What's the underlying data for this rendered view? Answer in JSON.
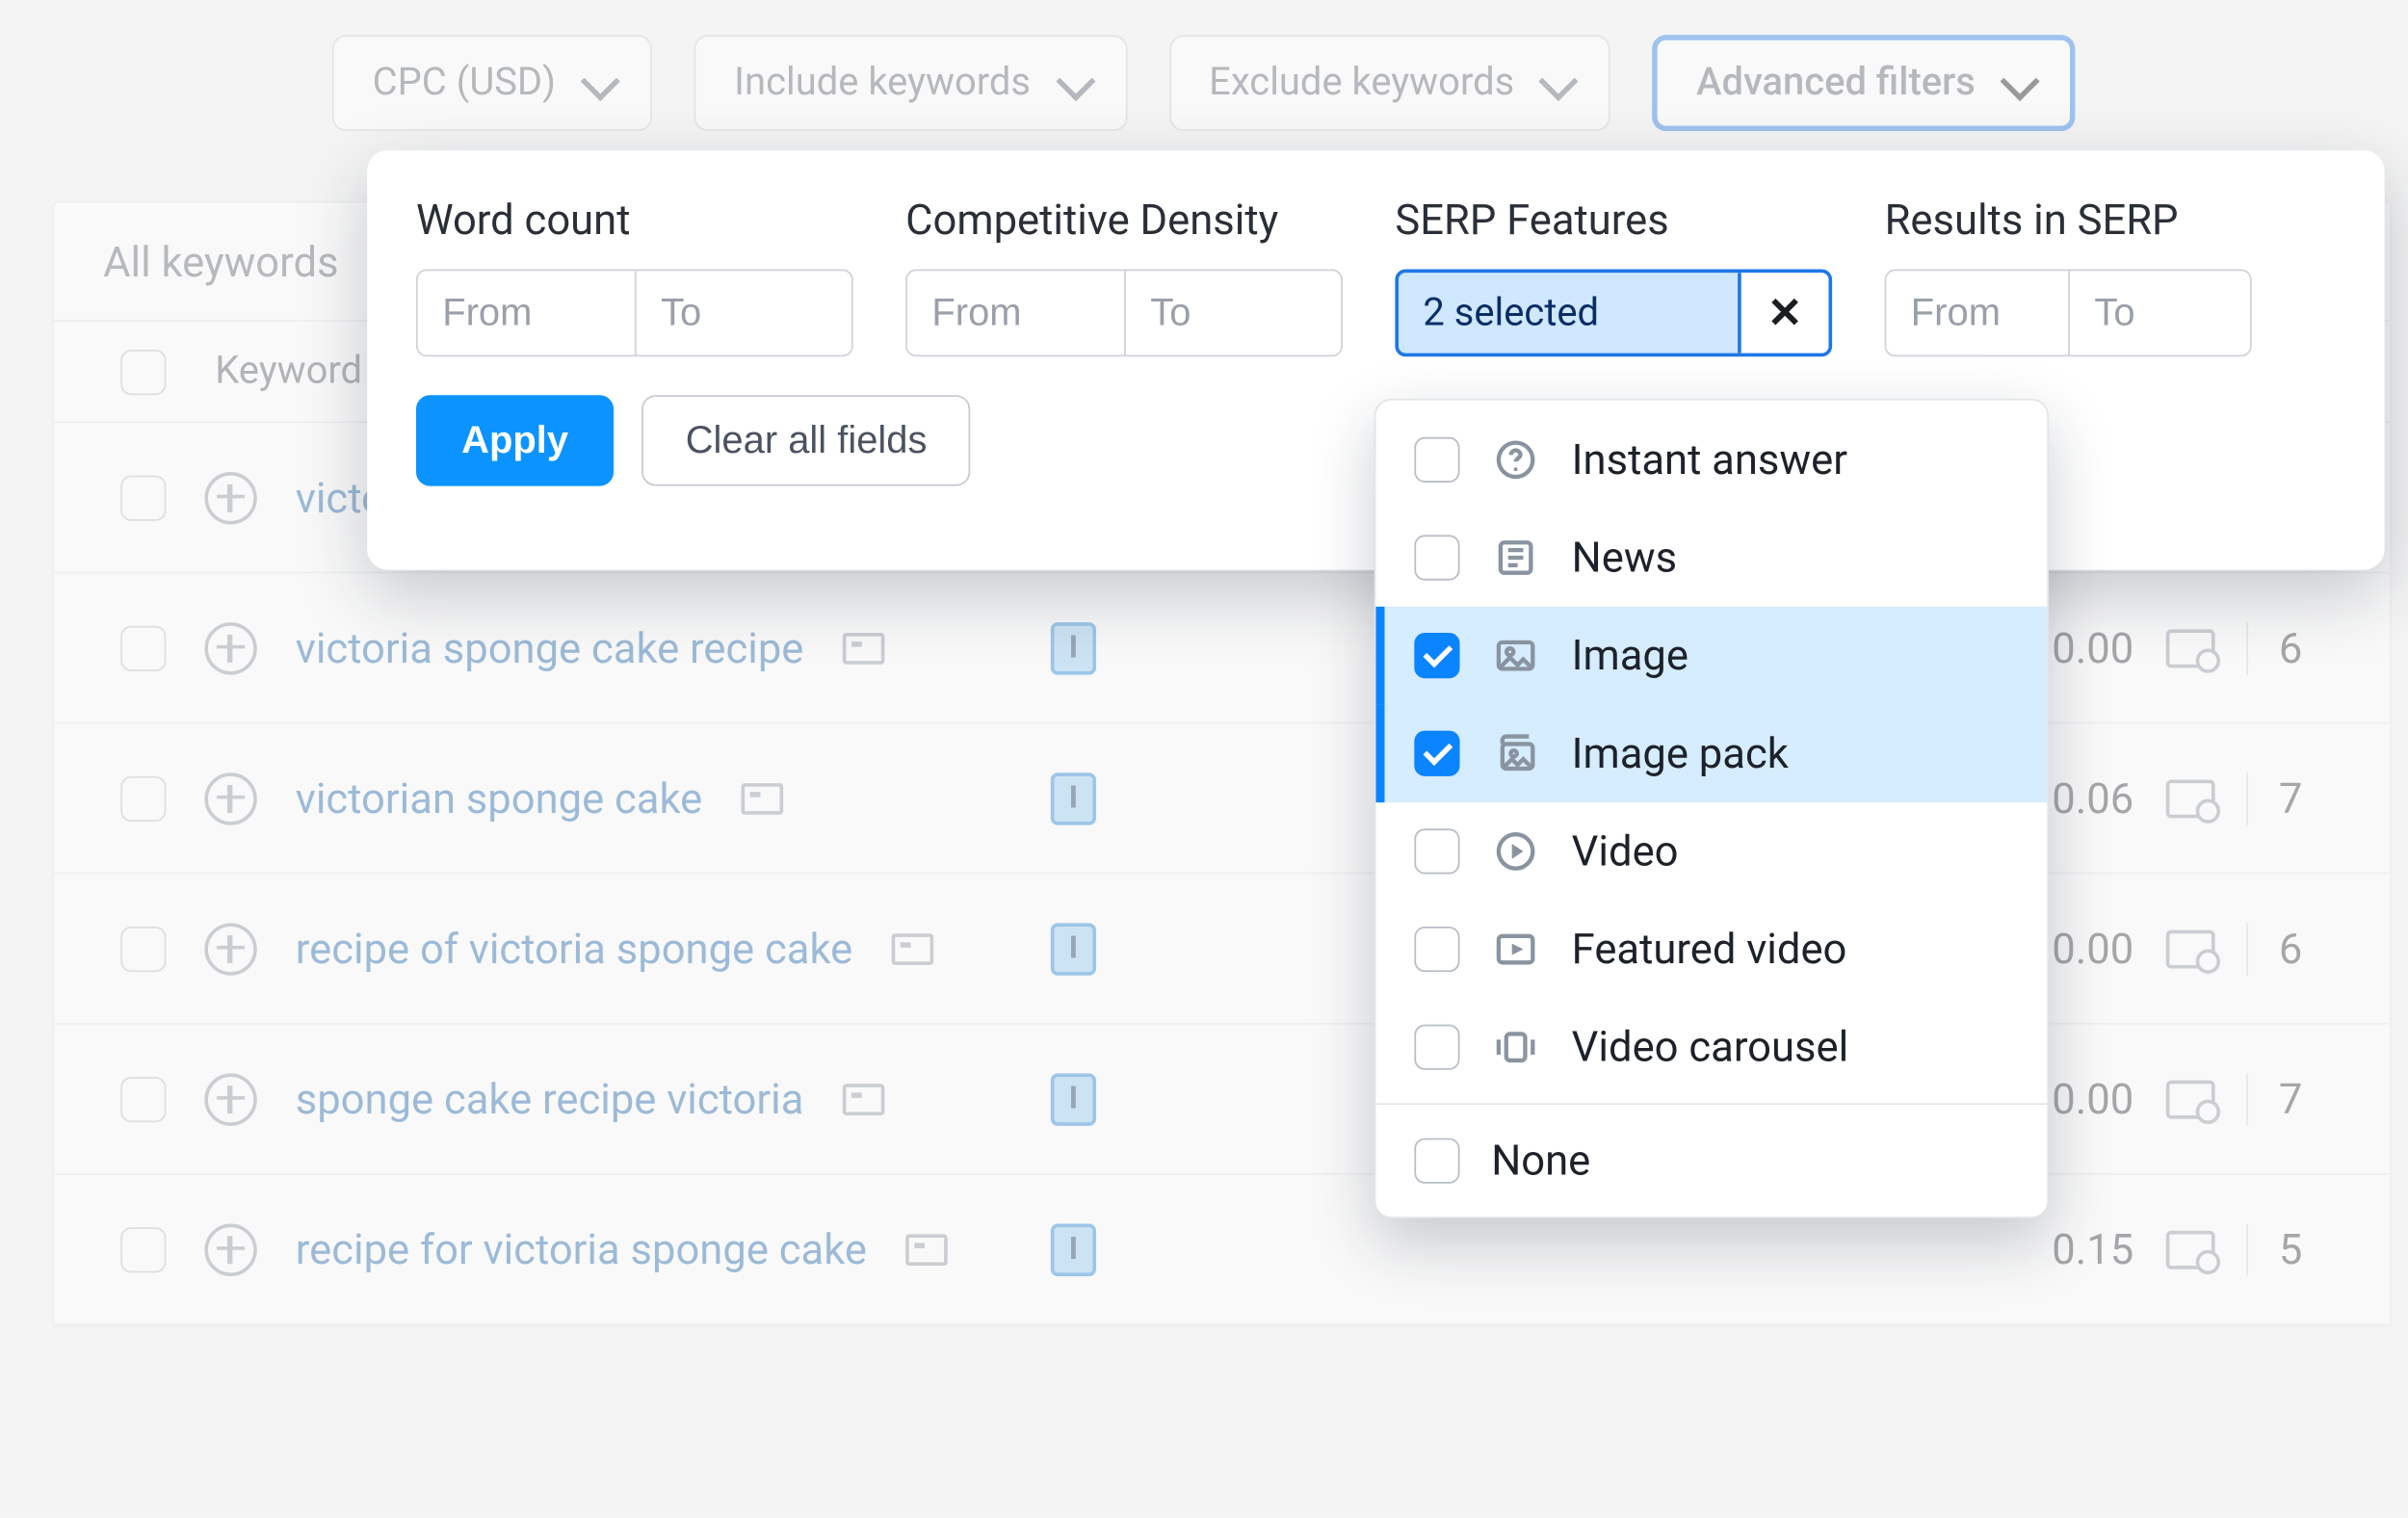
{
  "filters": {
    "pills": [
      "CPC (USD)",
      "Include keywords",
      "Exclude keywords",
      "Advanced filters"
    ]
  },
  "advanced_popup": {
    "word_count_label": "Word count",
    "competitive_density_label": "Competitive Density",
    "serp_features_label": "SERP Features",
    "results_in_serp_label": "Results in SERP",
    "from_placeholder": "From",
    "to_placeholder": "To",
    "serp_selected_text": "2 selected",
    "apply_label": "Apply",
    "clear_label": "Clear all fields"
  },
  "serp_dropdown": {
    "options": [
      {
        "label": "Instant answer",
        "icon": "question-circle",
        "checked": false
      },
      {
        "label": "News",
        "icon": "news",
        "checked": false
      },
      {
        "label": "Image",
        "icon": "image",
        "checked": true
      },
      {
        "label": "Image pack",
        "icon": "image-pack",
        "checked": true
      },
      {
        "label": "Video",
        "icon": "play-circle",
        "checked": false
      },
      {
        "label": "Featured video",
        "icon": "play-box",
        "checked": false
      },
      {
        "label": "Video carousel",
        "icon": "carousel",
        "checked": false
      }
    ],
    "none_label": "None"
  },
  "table": {
    "tab_label": "All keywords",
    "column_keyword_label": "Keyword",
    "badge_letter": "I",
    "rows": [
      {
        "keyword": "victoria sponge cake",
        "cpc": null,
        "tail": null
      },
      {
        "keyword": "victoria sponge cake recipe",
        "cpc": "0.00",
        "tail": "6"
      },
      {
        "keyword": "victorian sponge cake",
        "cpc": "0.06",
        "tail": "7"
      },
      {
        "keyword": "recipe of victoria sponge cake",
        "cpc": "0.00",
        "tail": "6"
      },
      {
        "keyword": "sponge cake recipe victoria",
        "cpc": "0.00",
        "tail": "7"
      },
      {
        "keyword": "recipe for victoria sponge cake",
        "cpc": "0.15",
        "tail": "5"
      }
    ]
  }
}
